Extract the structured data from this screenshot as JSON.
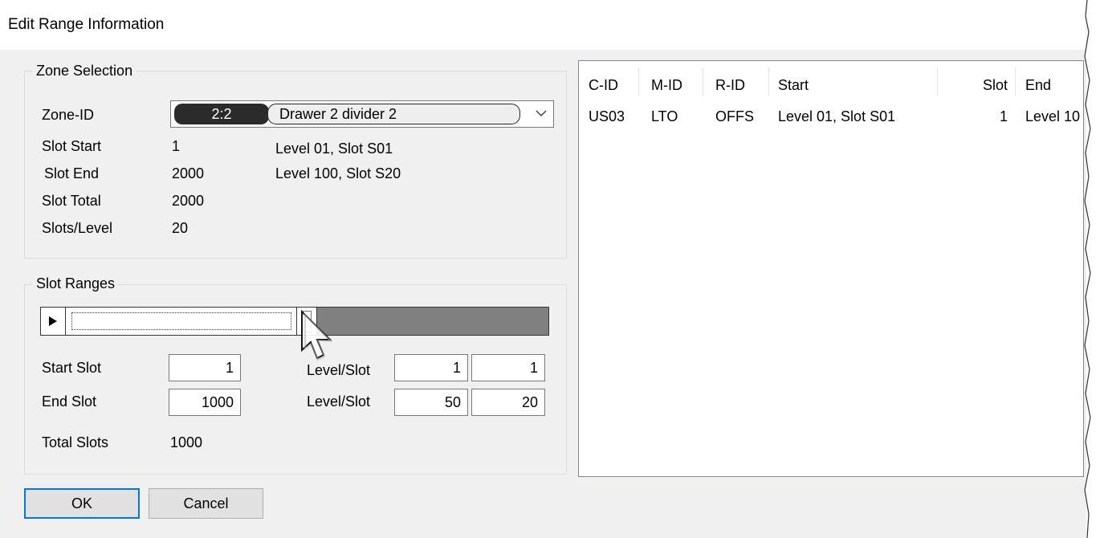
{
  "window": {
    "title": "Edit Range Information"
  },
  "zone_selection": {
    "legend": "Zone Selection",
    "zone_id_label": "Zone-ID",
    "zone_id_value": "2:2",
    "zone_name": "Drawer 2  divider 2",
    "rows": [
      {
        "label": "Slot Start",
        "value": "1",
        "desc": "Level 01, Slot S01"
      },
      {
        "label": "Slot End",
        "value": "2000",
        "desc": "Level 100, Slot S20"
      },
      {
        "label": "Slot Total",
        "value": "2000",
        "desc": ""
      },
      {
        "label": "Slots/Level",
        "value": "20",
        "desc": ""
      }
    ]
  },
  "slot_ranges": {
    "legend": "Slot Ranges",
    "start_label": "Start Slot",
    "start_value": "1",
    "end_label": "End Slot",
    "end_value": "1000",
    "level_slot_label": "Level/Slot",
    "start_level": "1",
    "start_slot": "1",
    "end_level": "50",
    "end_slot": "20",
    "total_label": "Total Slots",
    "total_value": "1000"
  },
  "buttons": {
    "ok": "OK",
    "cancel": "Cancel"
  },
  "list": {
    "columns": [
      "C-ID",
      "M-ID",
      "R-ID",
      "Start",
      "Slot",
      "End"
    ],
    "rows": [
      [
        "US03",
        "LTO",
        "OFFS",
        "Level 01, Slot S01",
        "1",
        "Level 10"
      ]
    ]
  },
  "colors": {
    "accent": "#0078d7",
    "slider_fill": "#808080",
    "pill_dark": "#2b2b2b"
  }
}
